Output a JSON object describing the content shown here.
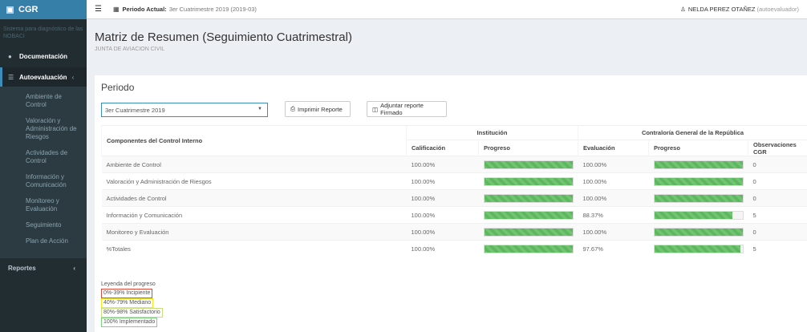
{
  "app": {
    "logo": "CGR",
    "system_desc": "Sistema para diagnóstico de las NOBACI"
  },
  "sidebar": {
    "documentacion": "Documentación",
    "autoevaluacion": "Autoevaluación",
    "sub_items": [
      "Ambiente de Control",
      "Valoración y Administración de Riesgos",
      "Actividades de Control",
      "Información y Comunicación",
      "Monitoreo y Evaluación",
      "Seguimiento",
      "Plan de Acción"
    ],
    "reportes": "Reportes"
  },
  "topbar": {
    "period_label": "Periodo Actual:",
    "period_value": "3er Cuatrimestre 2019 (2019-03)",
    "user": "NELDA PEREZ OTAÑEZ",
    "role": "(autoevaluador)"
  },
  "page": {
    "title": "Matriz de Resumen (Seguimiento Cuatrimestral)",
    "subtitle": "JUNTA DE AVIACION CIVIL"
  },
  "form": {
    "periodo_title": "Periodo",
    "periodo_value": "3er Cuatrimestre 2019",
    "print_label": "Imprimir Reporte",
    "upload_label": "Adjuntar reporte Firmado"
  },
  "table": {
    "h_componentes": "Componentes del Control Interno",
    "h_institucion": "Institución",
    "h_contraloria": "Contraloría General de la República",
    "h_calificacion": "Calificación",
    "h_progreso": "Progreso",
    "h_evaluacion": "Evaluación",
    "h_progreso2": "Progreso",
    "h_observaciones": "Observaciones CGR",
    "rows": [
      {
        "name": "Ambiente de Control",
        "calificacion": "100.00%",
        "inst_progress": 100,
        "evaluacion": "100.00%",
        "cgr_progress": 100,
        "obs": "0"
      },
      {
        "name": "Valoración y Administración de Riesgos",
        "calificacion": "100.00%",
        "inst_progress": 100,
        "evaluacion": "100.00%",
        "cgr_progress": 100,
        "obs": "0"
      },
      {
        "name": "Actividades de Control",
        "calificacion": "100.00%",
        "inst_progress": 100,
        "evaluacion": "100.00%",
        "cgr_progress": 100,
        "obs": "0"
      },
      {
        "name": "Información y Comunicación",
        "calificacion": "100.00%",
        "inst_progress": 100,
        "evaluacion": "88.37%",
        "cgr_progress": 88.37,
        "obs": "5"
      },
      {
        "name": "Monitoreo y Evaluación",
        "calificacion": "100.00%",
        "inst_progress": 100,
        "evaluacion": "100.00%",
        "cgr_progress": 100,
        "obs": "0"
      },
      {
        "name": "%Totales",
        "calificacion": "100.00%",
        "inst_progress": 100,
        "evaluacion": "97.67%",
        "cgr_progress": 97.67,
        "obs": "5"
      }
    ]
  },
  "legend": {
    "title": "Leyenda del progreso",
    "l1": "0%-39% Incipiente",
    "l2": "40%-79% Mediano",
    "l3": "80%-98% Satisfactorio",
    "l4": "100% Implementado"
  },
  "colors": {
    "progress": "#5cb85c",
    "sidebar": "#222d32",
    "logo": "#367fa9"
  }
}
